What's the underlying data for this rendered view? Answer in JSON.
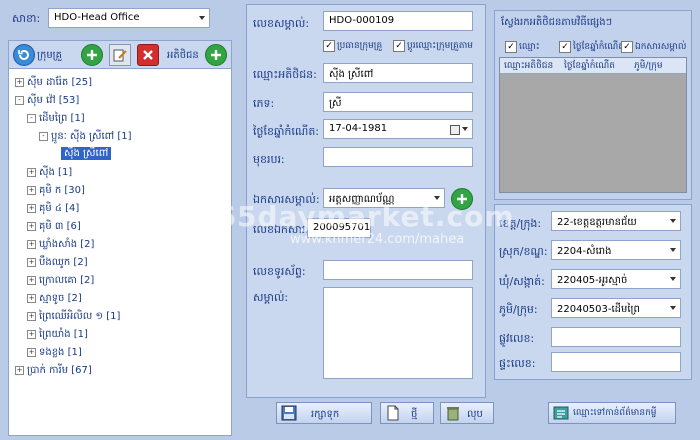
{
  "branch": {
    "label": "សាខា:",
    "value": "HDO-Head Office"
  },
  "toolbar": {
    "group_label": "ក្រុមគ្រួ",
    "customer_label": "អតិថិជន"
  },
  "tree": [
    {
      "text": "ស៊ីម ដារ៉ែត [25]",
      "toggle": "+"
    },
    {
      "text": "ស៊ីម វ៉ៅ [53]",
      "toggle": "-"
    },
    {
      "text": "ដើមព្រៃ [1]",
      "toggle": "-"
    },
    {
      "text": "ប្អូនៈ ស៊ីង ស្រីពៅ [1]",
      "toggle": "-"
    },
    {
      "text": "ស៊ីង ស្រីពៅ",
      "toggle": ""
    },
    {
      "text": "ស៊ីង [1]",
      "toggle": "+"
    },
    {
      "text": "គុមិ ក [30]",
      "toggle": "+"
    },
    {
      "text": "គុមិ ៤ [4]",
      "toggle": "+"
    },
    {
      "text": "គុមិ ៣ [6]",
      "toggle": "+"
    },
    {
      "text": "ឃ្លាំងសាំង [2]",
      "toggle": "+"
    },
    {
      "text": "បឹងឈូក [2]",
      "toggle": "+"
    },
    {
      "text": "ក្រោលគោ [2]",
      "toggle": "+"
    },
    {
      "text": "ស្មាទូច [2]",
      "toggle": "+"
    },
    {
      "text": "ព្រៃឈើអិលិល ១ [1]",
      "toggle": "+"
    },
    {
      "text": "ព្រៃយាំង [1]",
      "toggle": "+"
    },
    {
      "text": "ទងខ្លង [1]",
      "toggle": "+"
    },
    {
      "text": "ប្រាក់ ការីម [67]",
      "toggle": "+"
    }
  ],
  "form": {
    "id_label": "លេខសម្គាល់:",
    "id_value": "HDO-000109",
    "chk_head_label": "ប្រធានក្រុមគ្រួ",
    "chk_group_label": "ប្តូរឈ្មោះក្រុមគ្រួតាម",
    "name_label": "ឈ្មោះអតិថិជន:",
    "name_value": "ស៊ីង ស្រីពៅ",
    "gender_label": "ភេទ:",
    "gender_value": "ស្រី",
    "dob_label": "ថ្ងៃខែឆ្នាំកំណើត:",
    "dob_value": "17-04-1981",
    "occupation_label": "មុខរបរ:",
    "occupation_value": "",
    "doc_label": "ឯកសារសម្គាល់:",
    "doc_value": "អត្តសញ្ញាណប័ណ្ណ",
    "docno_label": "លេខឯកសារ:",
    "docno_value": "200095701",
    "phone_label": "លេខទូរស័ព្ទ:",
    "phone_value": "",
    "note_label": "សម្គាល់:",
    "note_value": ""
  },
  "search": {
    "title": "ស្វែងរកអតិថិជនតាមវិធីផ្សេងៗ",
    "chk_name": "ឈ្មោះ",
    "chk_dob": "ថ្ងៃខែឆ្នាំកំណើត",
    "chk_doc": "ឯកសារសម្គាល់",
    "col_name": "ឈ្មោះអតិថិជន",
    "col_dob": "ថ្ងៃខែឆ្នាំកំណើត",
    "col_village": "ភូមិ/ក្រុម"
  },
  "address": {
    "province_label": "ខេត្ត/ក្រុង:",
    "province_value": "22-ខេត្តឧត្តរមានជ័យ",
    "district_label": "ស្រុក/ខណ្ឌ:",
    "district_value": "2204-សំរោង",
    "commune_label": "ឃុំ/សង្កាត់:",
    "commune_value": "220405-អូរស្មាច់",
    "village_label": "ភូមិ/ក្រុម:",
    "village_value": "22040503-ដើមព្រៃ",
    "street_label": "ផ្លូវលេខ:",
    "street_value": "",
    "house_label": "ផ្ទះលេខ:",
    "house_value": ""
  },
  "buttons": {
    "save": "រក្សាទុក",
    "new": "ថ្មី",
    "delete": "លុប",
    "goto": "ឈ្មោះទៅកាន់ព័ត៌មានកម្ចី"
  },
  "watermark": {
    "line1": "365daymarket.com",
    "line2": "www.khmer24.com/mahea"
  }
}
